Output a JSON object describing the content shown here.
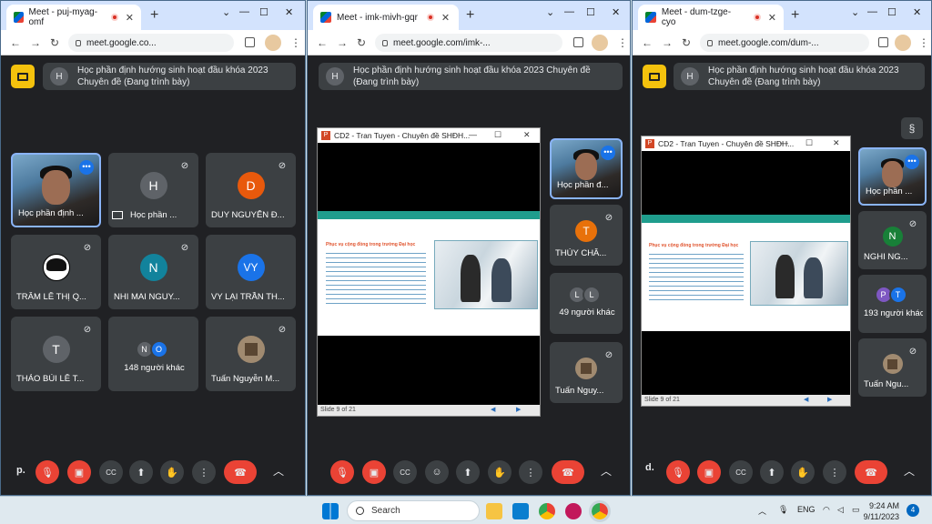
{
  "windows": [
    {
      "tab_title": "Meet - puj-myag-omf",
      "url": "meet.google.co...",
      "banner": "Học phần định hướng sinh hoạt đầu khóa 2023 Chuyên đề (Đang trình bày)",
      "banner_initial": "H",
      "tiles": [
        {
          "name": "Học phần định ...",
          "type": "camera"
        },
        {
          "name": "Học phần ...",
          "initial": "H",
          "color": "#5f6368"
        },
        {
          "name": "DUY NGUYỄN Đ...",
          "initial": "D",
          "color": "#e8590c"
        },
        {
          "name": "TRÂM LÊ THỊ Q...",
          "type": "anime"
        },
        {
          "name": "NHI MAI NGUY...",
          "initial": "N",
          "color": "#12839c"
        },
        {
          "name": "VY LẠI TRẦN TH...",
          "initial": "VY",
          "color": "#1a73e8"
        },
        {
          "name": "THẢO BÙI LÊ T...",
          "initial": "T",
          "color": "#5f6368"
        },
        {
          "name": "148 người khác",
          "pair": [
            "N",
            "O"
          ],
          "pair_colors": [
            "#5f6368",
            "#1a73e8"
          ]
        },
        {
          "name": "Tuấn Nguyễn M...",
          "type": "pixel"
        }
      ],
      "user": "p."
    },
    {
      "tab_title": "Meet - imk-mivh-gqr",
      "url": "meet.google.com/imk-...",
      "banner": "Học phần định hướng sinh hoạt đầu khóa 2023 Chuyên đề (Đang trình bày)",
      "banner_initial": "H",
      "ppt_title": "CD2 - Tran Tuyen - Chuyên đề SHĐH...",
      "slide_status": "Slide 9 of 21",
      "slide_heading": "Phục vụ cộng đồng trong trường Đại học",
      "side": [
        {
          "name": "Học phần đ...",
          "type": "camera"
        },
        {
          "name": "THÙY CHÂ...",
          "initial": "T",
          "color": "#e8710a"
        },
        {
          "name": "49 người khác",
          "pair": [
            "L",
            "L"
          ],
          "pair_colors": [
            "#5f6368",
            "#5f6368"
          ]
        },
        {
          "name": "Tuấn Nguy...",
          "type": "pixel"
        }
      ]
    },
    {
      "tab_title": "Meet - dum-tzge-cyo",
      "url": "meet.google.com/dum-...",
      "banner": "Học phần định hướng sinh hoạt đầu khóa 2023 Chuyên đề (Đang trình bày)",
      "banner_initial": "H",
      "ppt_title": "CD2 - Tran Tuyen - Chuyên đề SHĐH...",
      "slide_status": "Slide 9 of 21",
      "slide_heading": "Phục vụ cộng đồng trong trường Đại học",
      "side": [
        {
          "name": "Học phần ...",
          "type": "camera"
        },
        {
          "name": "NGHI NG...",
          "initial": "N",
          "color": "#188038"
        },
        {
          "name": "193 người khác",
          "pair": [
            "P",
            "T"
          ],
          "pair_colors": [
            "#7e57c2",
            "#1a73e8"
          ]
        },
        {
          "name": "Tuấn Ngu...",
          "type": "pixel"
        }
      ],
      "user": "d."
    }
  ],
  "taskbar": {
    "search": "Search",
    "lang": "ENG",
    "time": "9:24 AM",
    "date": "9/11/2023",
    "notifications": "4"
  }
}
